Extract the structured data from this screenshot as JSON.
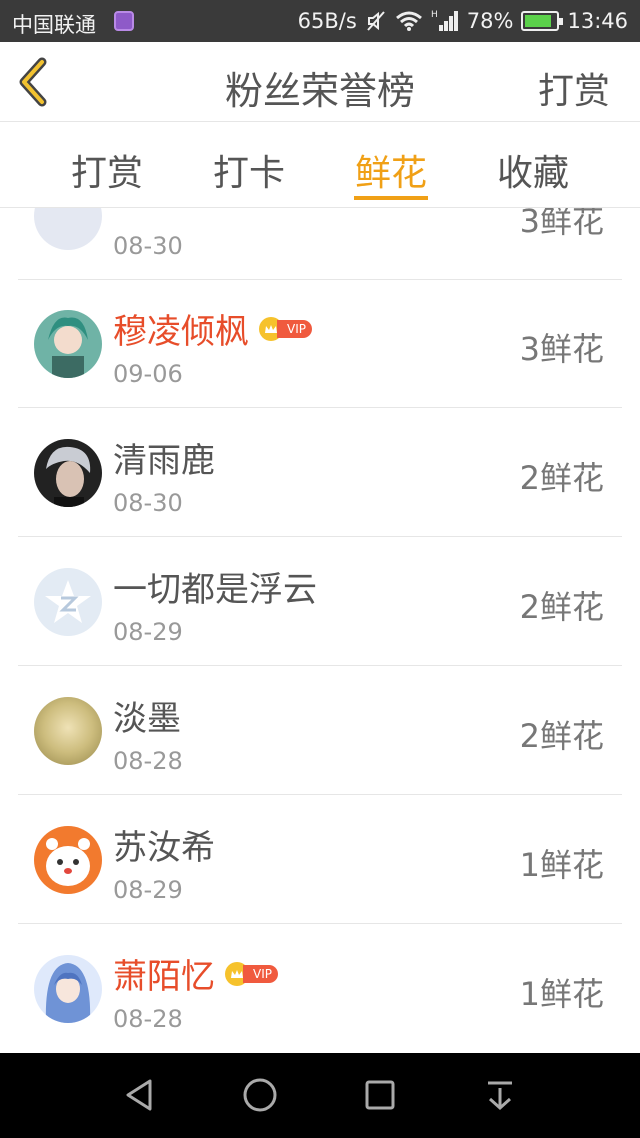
{
  "status_bar": {
    "carrier": "中国联通",
    "speed": "65B/s",
    "battery": "78%",
    "time": "13:46"
  },
  "header": {
    "title": "粉丝荣誉榜",
    "action": "打赏"
  },
  "tabs": [
    {
      "label": "打赏",
      "active": false
    },
    {
      "label": "打卡",
      "active": false
    },
    {
      "label": "鲜花",
      "active": true
    },
    {
      "label": "收藏",
      "active": false
    }
  ],
  "list": [
    {
      "name": "",
      "date": "08-30",
      "count": "3鲜花",
      "vip": false,
      "avatar": "default-avatar"
    },
    {
      "name": "穆凌倾枫",
      "date": "09-06",
      "count": "3鲜花",
      "vip": true,
      "vip_label": "VIP",
      "avatar": "anime-avatar"
    },
    {
      "name": "清雨鹿",
      "date": "08-30",
      "count": "2鲜花",
      "vip": false,
      "avatar": "photo-avatar"
    },
    {
      "name": "一切都是浮云",
      "date": "08-29",
      "count": "2鲜花",
      "vip": false,
      "avatar": "qq-default-avatar"
    },
    {
      "name": "淡墨",
      "date": "08-28",
      "count": "2鲜花",
      "vip": false,
      "avatar": "blurred-avatar"
    },
    {
      "name": "苏汝希",
      "date": "08-29",
      "count": "1鲜花",
      "vip": false,
      "avatar": "cartoon-avatar"
    },
    {
      "name": "萧陌忆",
      "date": "08-28",
      "count": "1鲜花",
      "vip": true,
      "vip_label": "VIP",
      "avatar": "anime-girl-avatar"
    }
  ],
  "colors": {
    "accent": "#f0a016",
    "vip_name": "#e74d2a"
  }
}
